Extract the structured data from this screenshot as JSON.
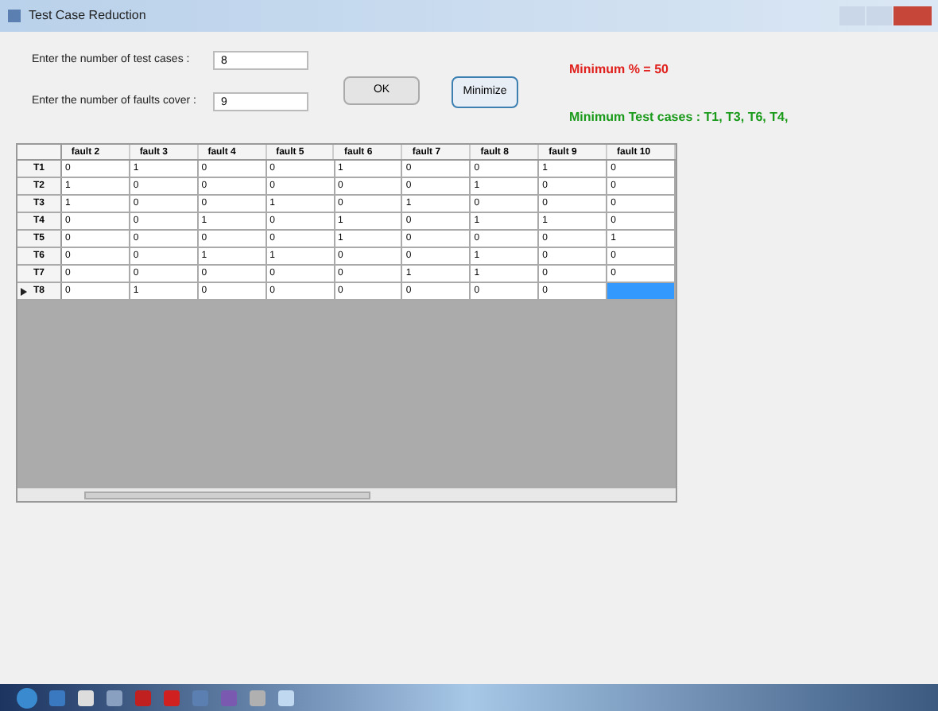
{
  "window": {
    "title": "Test Case Reduction"
  },
  "inputs": [
    {
      "label": "Enter the number of test cases :",
      "value": "8"
    },
    {
      "label": "Enter the number of faults cover :",
      "value": "9"
    }
  ],
  "buttons": [
    "OK",
    "Minimize"
  ],
  "results": [
    {
      "text": "Minimum % = 50",
      "color": "#e0201c"
    },
    {
      "text": "Minimum Test cases : T1, T3, T6, T4,",
      "color": "#1a9a1a"
    }
  ],
  "grid": {
    "columns": [
      "fault 2",
      "fault 3",
      "fault 4",
      "fault 5",
      "fault 6",
      "fault 7",
      "fault 8",
      "fault 9",
      "fault 10"
    ],
    "rows": [
      {
        "header": "T1",
        "current": false,
        "cells": [
          {
            "value": "0",
            "selected": false
          },
          {
            "value": "1",
            "selected": false
          },
          {
            "value": "0",
            "selected": false
          },
          {
            "value": "0",
            "selected": false
          },
          {
            "value": "1",
            "selected": false
          },
          {
            "value": "0",
            "selected": false
          },
          {
            "value": "0",
            "selected": false
          },
          {
            "value": "1",
            "selected": false
          },
          {
            "value": "0",
            "selected": false
          }
        ]
      },
      {
        "header": "T2",
        "current": false,
        "cells": [
          {
            "value": "1",
            "selected": false
          },
          {
            "value": "0",
            "selected": false
          },
          {
            "value": "0",
            "selected": false
          },
          {
            "value": "0",
            "selected": false
          },
          {
            "value": "0",
            "selected": false
          },
          {
            "value": "0",
            "selected": false
          },
          {
            "value": "1",
            "selected": false
          },
          {
            "value": "0",
            "selected": false
          },
          {
            "value": "0",
            "selected": false
          }
        ]
      },
      {
        "header": "T3",
        "current": false,
        "cells": [
          {
            "value": "1",
            "selected": false
          },
          {
            "value": "0",
            "selected": false
          },
          {
            "value": "0",
            "selected": false
          },
          {
            "value": "1",
            "selected": false
          },
          {
            "value": "0",
            "selected": false
          },
          {
            "value": "1",
            "selected": false
          },
          {
            "value": "0",
            "selected": false
          },
          {
            "value": "0",
            "selected": false
          },
          {
            "value": "0",
            "selected": false
          }
        ]
      },
      {
        "header": "T4",
        "current": false,
        "cells": [
          {
            "value": "0",
            "selected": false
          },
          {
            "value": "0",
            "selected": false
          },
          {
            "value": "1",
            "selected": false
          },
          {
            "value": "0",
            "selected": false
          },
          {
            "value": "1",
            "selected": false
          },
          {
            "value": "0",
            "selected": false
          },
          {
            "value": "1",
            "selected": false
          },
          {
            "value": "1",
            "selected": false
          },
          {
            "value": "0",
            "selected": false
          }
        ]
      },
      {
        "header": "T5",
        "current": false,
        "cells": [
          {
            "value": "0",
            "selected": false
          },
          {
            "value": "0",
            "selected": false
          },
          {
            "value": "0",
            "selected": false
          },
          {
            "value": "0",
            "selected": false
          },
          {
            "value": "1",
            "selected": false
          },
          {
            "value": "0",
            "selected": false
          },
          {
            "value": "0",
            "selected": false
          },
          {
            "value": "0",
            "selected": false
          },
          {
            "value": "1",
            "selected": false
          }
        ]
      },
      {
        "header": "T6",
        "current": false,
        "cells": [
          {
            "value": "0",
            "selected": false
          },
          {
            "value": "0",
            "selected": false
          },
          {
            "value": "1",
            "selected": false
          },
          {
            "value": "1",
            "selected": false
          },
          {
            "value": "0",
            "selected": false
          },
          {
            "value": "0",
            "selected": false
          },
          {
            "value": "1",
            "selected": false
          },
          {
            "value": "0",
            "selected": false
          },
          {
            "value": "0",
            "selected": false
          }
        ]
      },
      {
        "header": "T7",
        "current": false,
        "cells": [
          {
            "value": "0",
            "selected": false
          },
          {
            "value": "0",
            "selected": false
          },
          {
            "value": "0",
            "selected": false
          },
          {
            "value": "0",
            "selected": false
          },
          {
            "value": "0",
            "selected": false
          },
          {
            "value": "1",
            "selected": false
          },
          {
            "value": "1",
            "selected": false
          },
          {
            "value": "0",
            "selected": false
          },
          {
            "value": "0",
            "selected": false
          }
        ]
      },
      {
        "header": "T8",
        "current": true,
        "cells": [
          {
            "value": "0",
            "selected": false
          },
          {
            "value": "1",
            "selected": false
          },
          {
            "value": "0",
            "selected": false
          },
          {
            "value": "0",
            "selected": false
          },
          {
            "value": "0",
            "selected": false
          },
          {
            "value": "0",
            "selected": false
          },
          {
            "value": "0",
            "selected": false
          },
          {
            "value": "0",
            "selected": false
          },
          {
            "selected": true
          }
        ]
      }
    ]
  }
}
